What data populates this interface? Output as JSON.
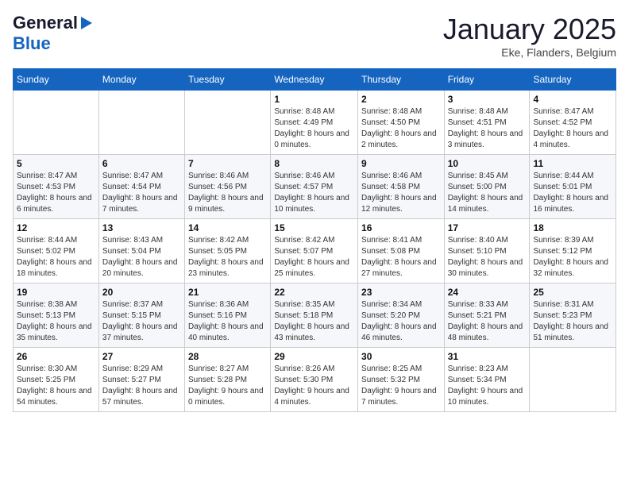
{
  "logo": {
    "line1": "General",
    "line2": "Blue"
  },
  "title": "January 2025",
  "location": "Eke, Flanders, Belgium",
  "weekdays": [
    "Sunday",
    "Monday",
    "Tuesday",
    "Wednesday",
    "Thursday",
    "Friday",
    "Saturday"
  ],
  "weeks": [
    [
      {
        "day": "",
        "info": ""
      },
      {
        "day": "",
        "info": ""
      },
      {
        "day": "",
        "info": ""
      },
      {
        "day": "1",
        "info": "Sunrise: 8:48 AM\nSunset: 4:49 PM\nDaylight: 8 hours\nand 0 minutes."
      },
      {
        "day": "2",
        "info": "Sunrise: 8:48 AM\nSunset: 4:50 PM\nDaylight: 8 hours\nand 2 minutes."
      },
      {
        "day": "3",
        "info": "Sunrise: 8:48 AM\nSunset: 4:51 PM\nDaylight: 8 hours\nand 3 minutes."
      },
      {
        "day": "4",
        "info": "Sunrise: 8:47 AM\nSunset: 4:52 PM\nDaylight: 8 hours\nand 4 minutes."
      }
    ],
    [
      {
        "day": "5",
        "info": "Sunrise: 8:47 AM\nSunset: 4:53 PM\nDaylight: 8 hours\nand 6 minutes."
      },
      {
        "day": "6",
        "info": "Sunrise: 8:47 AM\nSunset: 4:54 PM\nDaylight: 8 hours\nand 7 minutes."
      },
      {
        "day": "7",
        "info": "Sunrise: 8:46 AM\nSunset: 4:56 PM\nDaylight: 8 hours\nand 9 minutes."
      },
      {
        "day": "8",
        "info": "Sunrise: 8:46 AM\nSunset: 4:57 PM\nDaylight: 8 hours\nand 10 minutes."
      },
      {
        "day": "9",
        "info": "Sunrise: 8:46 AM\nSunset: 4:58 PM\nDaylight: 8 hours\nand 12 minutes."
      },
      {
        "day": "10",
        "info": "Sunrise: 8:45 AM\nSunset: 5:00 PM\nDaylight: 8 hours\nand 14 minutes."
      },
      {
        "day": "11",
        "info": "Sunrise: 8:44 AM\nSunset: 5:01 PM\nDaylight: 8 hours\nand 16 minutes."
      }
    ],
    [
      {
        "day": "12",
        "info": "Sunrise: 8:44 AM\nSunset: 5:02 PM\nDaylight: 8 hours\nand 18 minutes."
      },
      {
        "day": "13",
        "info": "Sunrise: 8:43 AM\nSunset: 5:04 PM\nDaylight: 8 hours\nand 20 minutes."
      },
      {
        "day": "14",
        "info": "Sunrise: 8:42 AM\nSunset: 5:05 PM\nDaylight: 8 hours\nand 23 minutes."
      },
      {
        "day": "15",
        "info": "Sunrise: 8:42 AM\nSunset: 5:07 PM\nDaylight: 8 hours\nand 25 minutes."
      },
      {
        "day": "16",
        "info": "Sunrise: 8:41 AM\nSunset: 5:08 PM\nDaylight: 8 hours\nand 27 minutes."
      },
      {
        "day": "17",
        "info": "Sunrise: 8:40 AM\nSunset: 5:10 PM\nDaylight: 8 hours\nand 30 minutes."
      },
      {
        "day": "18",
        "info": "Sunrise: 8:39 AM\nSunset: 5:12 PM\nDaylight: 8 hours\nand 32 minutes."
      }
    ],
    [
      {
        "day": "19",
        "info": "Sunrise: 8:38 AM\nSunset: 5:13 PM\nDaylight: 8 hours\nand 35 minutes."
      },
      {
        "day": "20",
        "info": "Sunrise: 8:37 AM\nSunset: 5:15 PM\nDaylight: 8 hours\nand 37 minutes."
      },
      {
        "day": "21",
        "info": "Sunrise: 8:36 AM\nSunset: 5:16 PM\nDaylight: 8 hours\nand 40 minutes."
      },
      {
        "day": "22",
        "info": "Sunrise: 8:35 AM\nSunset: 5:18 PM\nDaylight: 8 hours\nand 43 minutes."
      },
      {
        "day": "23",
        "info": "Sunrise: 8:34 AM\nSunset: 5:20 PM\nDaylight: 8 hours\nand 46 minutes."
      },
      {
        "day": "24",
        "info": "Sunrise: 8:33 AM\nSunset: 5:21 PM\nDaylight: 8 hours\nand 48 minutes."
      },
      {
        "day": "25",
        "info": "Sunrise: 8:31 AM\nSunset: 5:23 PM\nDaylight: 8 hours\nand 51 minutes."
      }
    ],
    [
      {
        "day": "26",
        "info": "Sunrise: 8:30 AM\nSunset: 5:25 PM\nDaylight: 8 hours\nand 54 minutes."
      },
      {
        "day": "27",
        "info": "Sunrise: 8:29 AM\nSunset: 5:27 PM\nDaylight: 8 hours\nand 57 minutes."
      },
      {
        "day": "28",
        "info": "Sunrise: 8:27 AM\nSunset: 5:28 PM\nDaylight: 9 hours\nand 0 minutes."
      },
      {
        "day": "29",
        "info": "Sunrise: 8:26 AM\nSunset: 5:30 PM\nDaylight: 9 hours\nand 4 minutes."
      },
      {
        "day": "30",
        "info": "Sunrise: 8:25 AM\nSunset: 5:32 PM\nDaylight: 9 hours\nand 7 minutes."
      },
      {
        "day": "31",
        "info": "Sunrise: 8:23 AM\nSunset: 5:34 PM\nDaylight: 9 hours\nand 10 minutes."
      },
      {
        "day": "",
        "info": ""
      }
    ]
  ]
}
